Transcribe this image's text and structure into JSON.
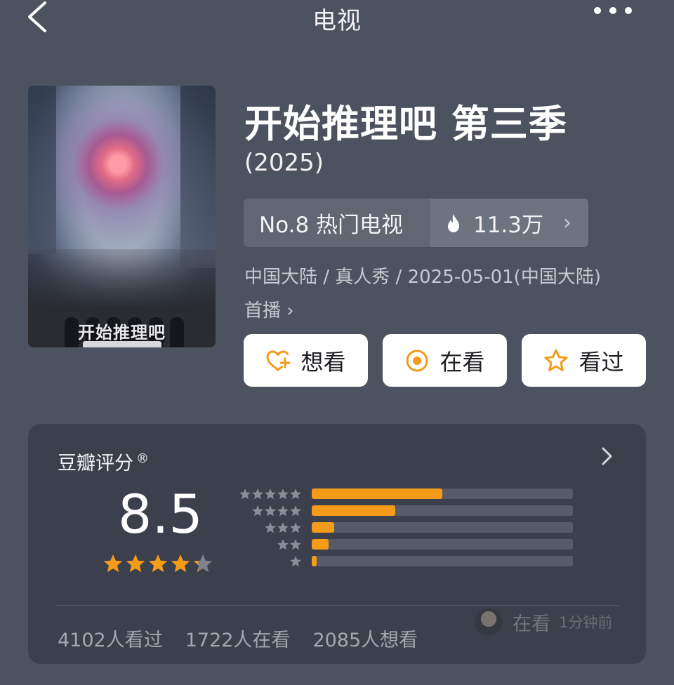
{
  "header": {
    "title": "电视",
    "back_icon": "chevron-left-icon",
    "more_icon": "more-horizontal-icon"
  },
  "poster": {
    "title_text": "开始推理吧"
  },
  "show": {
    "title": "开始推理吧 第三季",
    "year": "(2025)",
    "rank_label": "No.8 热门电视",
    "heat_label": "11.3万",
    "meta": "中国大陆 / 真人秀 / 2025-05-01(中国大陆)",
    "meta_more": "首播 ›"
  },
  "actions": [
    {
      "label": "想看",
      "icon": "heart-plus-icon"
    },
    {
      "label": "在看",
      "icon": "target-circle-icon"
    },
    {
      "label": "看过",
      "icon": "star-outline-icon"
    }
  ],
  "rating": {
    "label": "豆瓣评分",
    "mark": "®",
    "score": "8.5",
    "stars_value": 4.25,
    "distribution": [
      {
        "stars": 5,
        "fraction": 0.5
      },
      {
        "stars": 4,
        "fraction": 0.32
      },
      {
        "stars": 3,
        "fraction": 0.085
      },
      {
        "stars": 2,
        "fraction": 0.065
      },
      {
        "stars": 1,
        "fraction": 0.02
      }
    ],
    "counts": {
      "watched": "4102人看过",
      "watching": "1722人在看",
      "want": "2085人想看"
    },
    "activity": {
      "status": "在看",
      "time": "1分钟前"
    }
  },
  "colors": {
    "background": "#4d5260",
    "card": "#3c404c",
    "accent": "#f59b1a",
    "button_bg": "#ffffff"
  }
}
